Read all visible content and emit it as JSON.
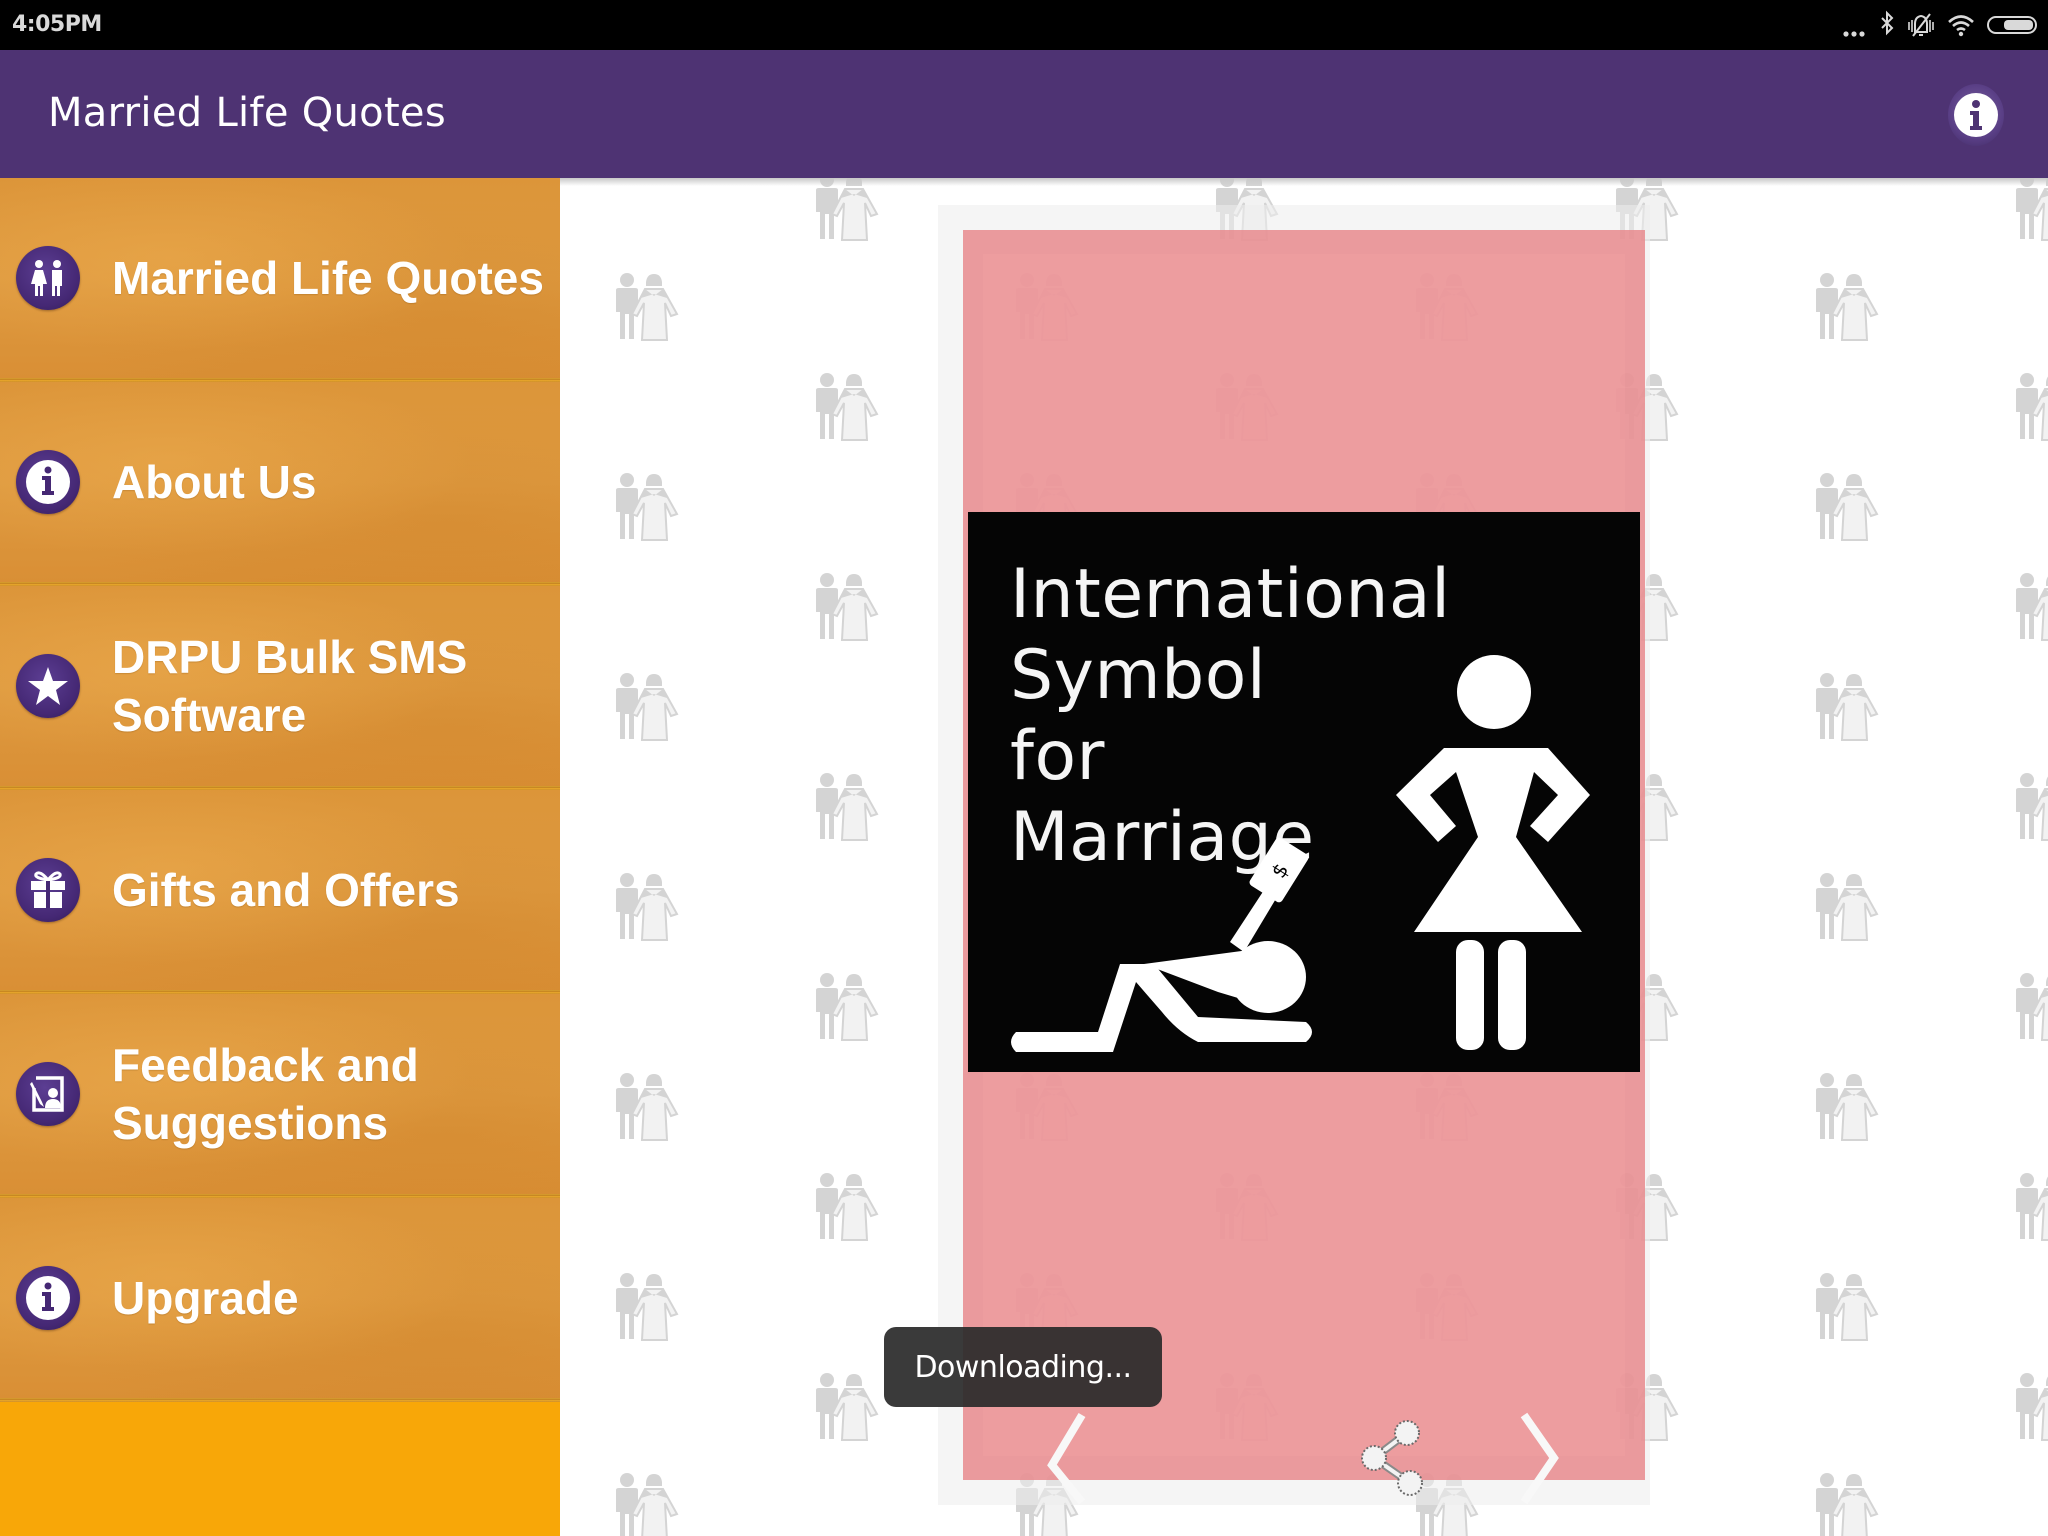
{
  "status_bar": {
    "time": "4:05PM",
    "icons": [
      "more-notifications-icon",
      "bluetooth-icon",
      "vibrate-off-icon",
      "wifi-icon",
      "battery-icon"
    ]
  },
  "toolbar": {
    "title": "Married Life Quotes",
    "info_icon": "info-icon"
  },
  "drawer": {
    "items": [
      {
        "label": "Married Life Quotes",
        "icon": "couple-icon"
      },
      {
        "label": "About Us",
        "icon": "info-icon"
      },
      {
        "label": "DRPU Bulk SMS Software",
        "icon": "star-icon"
      },
      {
        "label": "Gifts and Offers",
        "icon": "gift-icon"
      },
      {
        "label": "Feedback and Suggestions",
        "icon": "feedback-icon"
      },
      {
        "label": "Upgrade",
        "icon": "info-icon"
      }
    ]
  },
  "quote_card": {
    "image_text_lines": [
      "International",
      "Symbol",
      "for",
      "Marriage"
    ],
    "image_icon": "marriage-cartoon-illustration",
    "nav": {
      "prev_icon": "chevron-left-icon",
      "share_icon": "share-icon",
      "next_icon": "chevron-right-icon"
    }
  },
  "toast": {
    "message": "Downloading..."
  },
  "colors": {
    "toolbar": "#4e3373",
    "drawer_item": "#dc9539",
    "drawer_bottom": "#f8a708",
    "card_panel": "#e9969a",
    "icon_circle": "#452874",
    "toast": "#2b2b2b"
  }
}
